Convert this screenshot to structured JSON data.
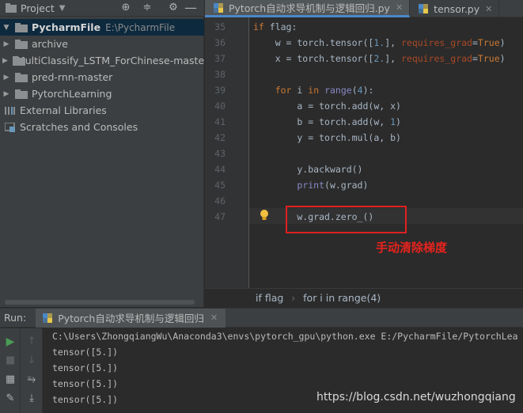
{
  "project": {
    "title": "Project",
    "dropdown_icon": "triangle-down",
    "header_icons": [
      "locate-icon",
      "collapse-all-icon",
      "settings-gear-icon",
      "hide-icon"
    ],
    "tree": [
      {
        "label": "PycharmFile",
        "path": "E:\\PycharmFile",
        "expanded": true,
        "selected": true,
        "level": 0
      },
      {
        "label": "archive",
        "level": 1
      },
      {
        "label": "MultiClassify_LSTM_ForChinese-master",
        "level": 1
      },
      {
        "label": "pred-rnn-master",
        "level": 1
      },
      {
        "label": "PytorchLearning",
        "level": 1
      },
      {
        "label": "External Libraries",
        "level": 0,
        "icon": "library-icon"
      },
      {
        "label": "Scratches and Consoles",
        "level": 0,
        "icon": "scratches-icon"
      }
    ]
  },
  "editor": {
    "tabs": [
      {
        "label": "Pytorch自动求导机制与逻辑回归.py",
        "active": true
      },
      {
        "label": "tensor.py",
        "active": false
      }
    ],
    "lines": [
      {
        "no": "35",
        "html": "<span class='kw'>if</span> flag:"
      },
      {
        "no": "36",
        "html": "    w = torch.tensor([<span class='num'>1.</span>], <span class='param'>requires_grad</span>=<span class='kw'>True</span>)"
      },
      {
        "no": "37",
        "html": "    x = torch.tensor([<span class='num'>2.</span>], <span class='param'>requires_grad</span>=<span class='kw'>True</span>)"
      },
      {
        "no": "38",
        "html": ""
      },
      {
        "no": "39",
        "html": "    <span class='kw'>for</span> i <span class='kw'>in</span> <span class='bi'>range</span>(<span class='num'>4</span>):"
      },
      {
        "no": "40",
        "html": "        a = torch.add(w, x)"
      },
      {
        "no": "41",
        "html": "        b = torch.add(w, <span class='num'>1</span>)"
      },
      {
        "no": "42",
        "html": "        y = torch.mul(a, b)"
      },
      {
        "no": "43",
        "html": ""
      },
      {
        "no": "44",
        "html": "        y.backward()"
      },
      {
        "no": "45",
        "html": "        <span class='bi'>print</span>(w.grad)"
      },
      {
        "no": "46",
        "html": ""
      },
      {
        "no": "47",
        "html": "        w.grad.zero_()"
      }
    ],
    "annotation": "手动清除梯度",
    "breadcrumb": [
      "if flag",
      "for i in range(4)"
    ]
  },
  "run": {
    "label": "Run:",
    "tab_label": "Pytorch自动求导机制与逻辑回归",
    "console": [
      "C:\\Users\\ZhongqiangWu\\Anaconda3\\envs\\pytorch_gpu\\python.exe E:/PycharmFile/PytorchLea",
      "tensor([5.])",
      "tensor([5.])",
      "tensor([5.])",
      "tensor([5.])"
    ]
  },
  "watermark": "https://blog.csdn.net/wuzhongqiang",
  "colors": {
    "accent": "#4a88c7",
    "annotation_red": "#e8231e",
    "keyword": "#cc7832",
    "number": "#6897bb"
  }
}
